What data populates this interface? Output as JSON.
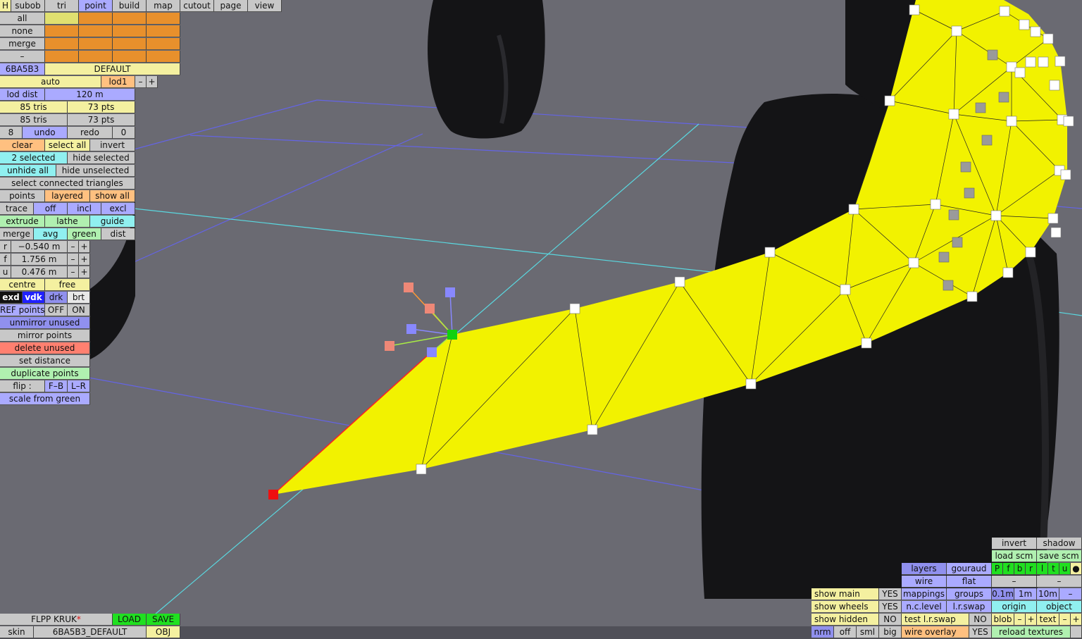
{
  "menu": {
    "h": "H",
    "tabs": [
      "subob",
      "tri",
      "point",
      "build",
      "map",
      "cutout",
      "page",
      "view"
    ],
    "active_tab": "point"
  },
  "selection": {
    "all": "all",
    "none": "none",
    "merge": "merge",
    "dash": "–"
  },
  "skin_row": {
    "code": "6BA5B3",
    "name": "DEFAULT"
  },
  "lod": {
    "auto": "auto",
    "lod1": "lod1",
    "minus": "–",
    "plus": "+",
    "dist_label": "lod dist",
    "dist_value": "120 m"
  },
  "counts": {
    "row1_tris": "85 tris",
    "row1_pts": "73 pts",
    "row2_tris": "85 tris",
    "row2_pts": "73 pts"
  },
  "history": {
    "undo_count": "8",
    "undo": "undo",
    "redo": "redo",
    "redo_count": "0"
  },
  "select_ops": {
    "clear": "clear",
    "select_all": "select all",
    "invert": "invert"
  },
  "hide_ops": {
    "selected": "2 selected",
    "hide_selected": "hide selected",
    "unhide_all": "unhide all",
    "hide_unselected": "hide unselected"
  },
  "connected": "select connected triangles",
  "points_row": {
    "points": "points",
    "layered": "layered",
    "show_all": "show all"
  },
  "trace_row": {
    "trace": "trace",
    "off": "off",
    "incl": "incl",
    "excl": "excl"
  },
  "extrude_row": {
    "extrude": "extrude",
    "lathe": "lathe",
    "guide": "guide"
  },
  "merge_row": {
    "merge": "merge",
    "avg": "avg",
    "green": "green",
    "dist": "dist"
  },
  "coords": [
    {
      "axis": "r",
      "value": "−0.540 m"
    },
    {
      "axis": "f",
      "value": "1.756 m"
    },
    {
      "axis": "u",
      "value": "0.476 m"
    }
  ],
  "coord_buttons": {
    "minus": "–",
    "plus": "+"
  },
  "centre_row": {
    "centre": "centre",
    "free": "free"
  },
  "view_mode": {
    "exd": "exd",
    "vdk": "vdk",
    "drk": "drk",
    "brt": "brt"
  },
  "ref_points": {
    "label": "REF points",
    "off": "OFF",
    "on": "ON"
  },
  "actions": {
    "unmirror": "unmirror unused",
    "mirror": "mirror points",
    "delete": "delete unused",
    "set_distance": "set distance",
    "duplicate": "duplicate points",
    "flip": "flip :",
    "flip_fb": "F–B",
    "flip_lr": "L–R",
    "scale": "scale from green"
  },
  "footer": {
    "model_name": "FLPP KRUK",
    "modified_mark": "*",
    "load": "LOAD",
    "save": "SAVE",
    "skin_label": "skin",
    "skin_value": "6BA5B3_DEFAULT",
    "obj": "OBJ"
  },
  "right_panel": {
    "invert": "invert",
    "shadow": "shadow",
    "load_scm": "load scm",
    "save_scm": "save scm",
    "layers": "layers",
    "gouraud": "gouraud",
    "flags": [
      "P",
      "f",
      "b",
      "r",
      "l",
      "t",
      "u",
      "●"
    ],
    "wire": "wire",
    "flat": "flat",
    "dash1": "–",
    "dash2": "–",
    "show_main": "show main",
    "show_main_val": "YES",
    "mappings": "mappings",
    "groups": "groups",
    "g01": "0.1m",
    "g1": "1m",
    "g10": "10m",
    "gdash": "–",
    "show_wheels": "show wheels",
    "show_wheels_val": "YES",
    "nc_level": "n.c.level",
    "lr_swap": "l.r.swap",
    "origin": "origin",
    "object": "object",
    "show_hidden": "show hidden",
    "show_hidden_val": "NO",
    "test_swap": "test l.r.swap",
    "test_swap_val": "NO",
    "blob": "blob",
    "text": "text",
    "nrm": "nrm",
    "off": "off",
    "sml": "sml",
    "big": "big",
    "wire_overlay": "wire overlay",
    "wire_overlay_val": "YES",
    "reload": "reload textures"
  },
  "colors": {
    "viewport_bg": "#6a6a72",
    "mesh": "#f2f200",
    "tyre": "#141416",
    "grid_cyan": "#60e0e0",
    "grid_blue": "#6060e0"
  }
}
